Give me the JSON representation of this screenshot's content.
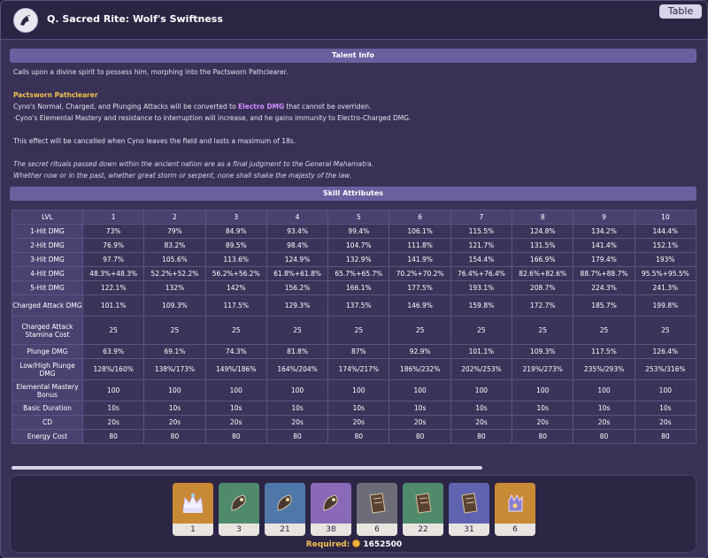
{
  "header": {
    "title": "Q. Sacred Rite: Wolf's Swiftness",
    "table_button": "Table"
  },
  "talent_info": {
    "heading": "Talent Info",
    "intro": "Calls upon a divine spirit to possess him, morphing into the Pactsworn Pathclearer.",
    "subheading": "Pactsworn Pathclearer",
    "line1_pre": "Cyno's Normal, Charged, and Plunging Attacks will be converted to ",
    "line1_electro": "Electro DMG",
    "line1_post": " that cannot be overriden.",
    "line2": "·Cyno's Elemental Mastery and resistance to interruption will increase, and he gains immunity to Electro-Charged DMG.",
    "line3": "This effect will be cancelled when Cyno leaves the field and lasts a maximum of 18s.",
    "flavor1": "The secret rituals passed down within the ancient nation are as a final judgment to the General Mahamatra.",
    "flavor2": "Whether now or in the past, whether great storm or serpent, none shall shake the majesty of the law.",
    "electro_color": "#d28cff",
    "subheading_color": "#f2c14e"
  },
  "skill_attributes": {
    "heading": "Skill Attributes",
    "columns": [
      "LVL",
      "1",
      "2",
      "3",
      "4",
      "5",
      "6",
      "7",
      "8",
      "9",
      "10"
    ],
    "rows": [
      {
        "label": "1-Hit DMG",
        "values": [
          "73%",
          "79%",
          "84.9%",
          "93.4%",
          "99.4%",
          "106.1%",
          "115.5%",
          "124.8%",
          "134.2%",
          "144.4%"
        ]
      },
      {
        "label": "2-Hit DMG",
        "values": [
          "76.9%",
          "83.2%",
          "89.5%",
          "98.4%",
          "104.7%",
          "111.8%",
          "121.7%",
          "131.5%",
          "141.4%",
          "152.1%"
        ]
      },
      {
        "label": "3-Hit DMG",
        "values": [
          "97.7%",
          "105.6%",
          "113.6%",
          "124.9%",
          "132.9%",
          "141.9%",
          "154.4%",
          "166.9%",
          "179.4%",
          "193%"
        ]
      },
      {
        "label": "4-Hit DMG",
        "values": [
          "48.3%+48.3%",
          "52.2%+52.2%",
          "56.2%+56.2%",
          "61.8%+61.8%",
          "65.7%+65.7%",
          "70.2%+70.2%",
          "76.4%+76.4%",
          "82.6%+82.6%",
          "88.7%+88.7%",
          "95.5%+95.5%"
        ]
      },
      {
        "label": "5-Hit DMG",
        "values": [
          "122.1%",
          "132%",
          "142%",
          "156.2%",
          "166.1%",
          "177.5%",
          "193.1%",
          "208.7%",
          "224.3%",
          "241.3%"
        ]
      },
      {
        "label": "Charged Attack DMG",
        "values": [
          "101.1%",
          "109.3%",
          "117.5%",
          "129.3%",
          "137.5%",
          "146.9%",
          "159.8%",
          "172.7%",
          "185.7%",
          "199.8%"
        ]
      },
      {
        "label": "Charged Attack Stamina Cost",
        "values": [
          "25",
          "25",
          "25",
          "25",
          "25",
          "25",
          "25",
          "25",
          "25",
          "25"
        ]
      },
      {
        "label": "Plunge DMG",
        "values": [
          "63.9%",
          "69.1%",
          "74.3%",
          "81.8%",
          "87%",
          "92.9%",
          "101.1%",
          "109.3%",
          "117.5%",
          "126.4%"
        ]
      },
      {
        "label": "Low/High Plunge DMG",
        "values": [
          "128%/160%",
          "138%/173%",
          "149%/186%",
          "164%/204%",
          "174%/217%",
          "186%/232%",
          "202%/253%",
          "219%/273%",
          "235%/293%",
          "253%/316%"
        ]
      },
      {
        "label": "Elemental Mastery Bonus",
        "values": [
          "100",
          "100",
          "100",
          "100",
          "100",
          "100",
          "100",
          "100",
          "100",
          "100"
        ]
      },
      {
        "label": "Basic Duration",
        "values": [
          "10s",
          "10s",
          "10s",
          "10s",
          "10s",
          "10s",
          "10s",
          "10s",
          "10s",
          "10s"
        ]
      },
      {
        "label": "CD",
        "values": [
          "20s",
          "20s",
          "20s",
          "20s",
          "20s",
          "20s",
          "20s",
          "20s",
          "20s",
          "20s"
        ]
      },
      {
        "label": "Energy Cost",
        "values": [
          "80",
          "80",
          "80",
          "80",
          "80",
          "80",
          "80",
          "80",
          "80",
          "80"
        ]
      }
    ]
  },
  "materials": {
    "items": [
      {
        "icon": "crown-icon",
        "count": "1",
        "bg": "#c98a35"
      },
      {
        "icon": "horn-icon",
        "count": "3",
        "bg": "#4f8a6c"
      },
      {
        "icon": "horn-icon",
        "count": "21",
        "bg": "#4f78a8"
      },
      {
        "icon": "horn-icon",
        "count": "38",
        "bg": "#8a6ab8"
      },
      {
        "icon": "book-icon",
        "count": "6",
        "bg": "#6d6d7a"
      },
      {
        "icon": "book-icon",
        "count": "22",
        "bg": "#4f8a6c"
      },
      {
        "icon": "book-icon",
        "count": "31",
        "bg": "#5f63b0"
      },
      {
        "icon": "gauntlet-icon",
        "count": "6",
        "bg": "#c98a35"
      }
    ],
    "required_label": "Required:",
    "required_value": "1652500"
  }
}
